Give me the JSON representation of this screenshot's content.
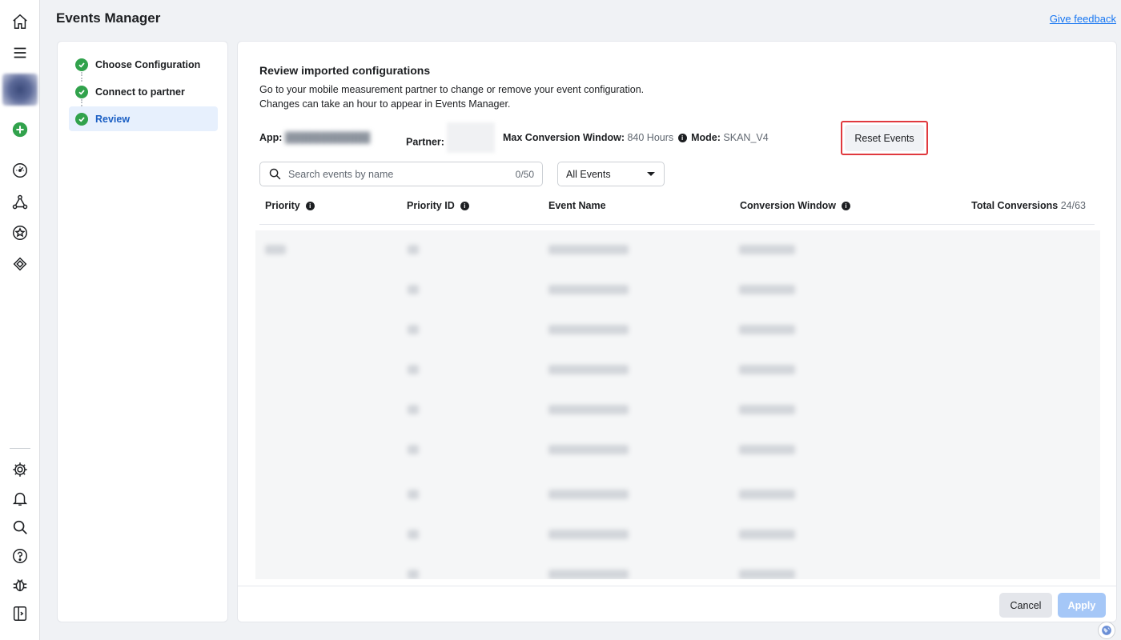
{
  "header": {
    "title": "Events Manager",
    "feedback_link": "Give feedback"
  },
  "rail": {
    "icons": [
      "home-icon",
      "menu-icon",
      "account-avatar",
      "add-icon",
      "dashboard-icon",
      "data-sources-icon",
      "custom-conversions-icon",
      "partner-integrations-icon",
      "settings-icon",
      "notifications-icon",
      "search-icon",
      "help-icon",
      "debug-icon",
      "collapse-sidebar-icon"
    ],
    "add_color": "#31a24c"
  },
  "steps": [
    {
      "label": "Choose Configuration",
      "status": "complete",
      "active": false
    },
    {
      "label": "Connect to partner",
      "status": "complete",
      "active": false
    },
    {
      "label": "Review",
      "status": "complete",
      "active": true
    }
  ],
  "review": {
    "title": "Review imported configurations",
    "description_line1": "Go to your mobile measurement partner to change or remove your event configuration.",
    "description_line2": "Changes can take an hour to appear in Events Manager.",
    "app_label": "App:",
    "partner_label": "Partner:",
    "max_window_label": "Max Conversion Window:",
    "max_window_value": "840 Hours",
    "mode_label": "Mode:",
    "mode_value": "SKAN_V4",
    "reset_button": "Reset Events"
  },
  "search": {
    "placeholder": "Search events by name",
    "count": "0/50"
  },
  "filter": {
    "selected": "All Events"
  },
  "table": {
    "columns": [
      "Priority",
      "Priority ID",
      "Event Name",
      "Conversion Window",
      "Total Conversions"
    ],
    "total_conversions": "24/63",
    "row_count_visible": 9
  },
  "footer": {
    "cancel": "Cancel",
    "apply": "Apply"
  },
  "colors": {
    "accent": "#1877f2",
    "check_green": "#31a24c",
    "highlight_border": "#e0393e",
    "apply_disabled": "#a5c7f7"
  }
}
